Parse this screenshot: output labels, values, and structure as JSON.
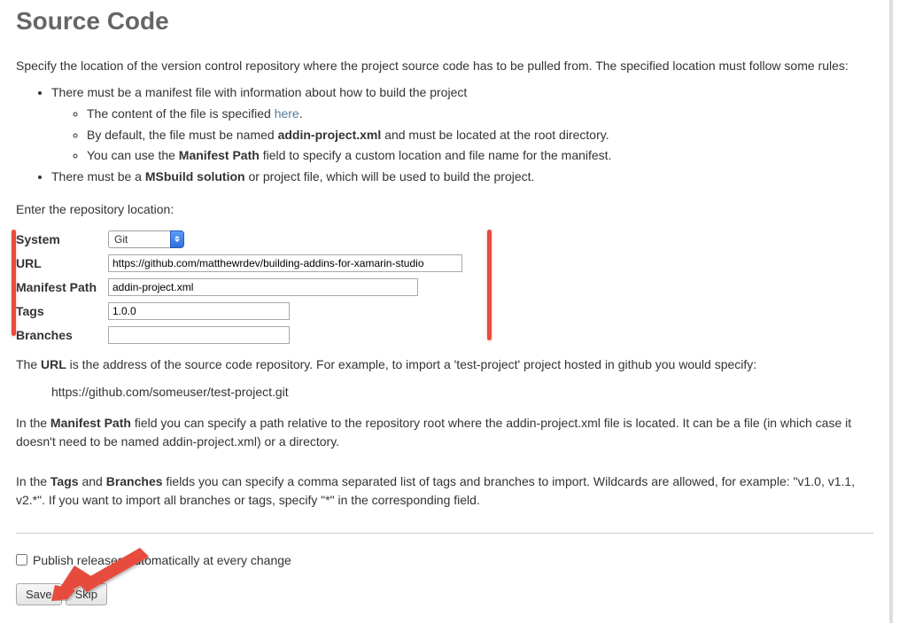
{
  "heading": "Source Code",
  "intro": "Specify the location of the version control repository where the project source code has to be pulled from. The specified location must follow some rules:",
  "rules": {
    "item1": "There must be a manifest file with information about how to build the project",
    "sub1a_prefix": "The content of the file is specified ",
    "sub1a_link": "here",
    "sub1a_suffix": ".",
    "sub1b_prefix": "By default, the file must be named ",
    "sub1b_bold": "addin-project.xml",
    "sub1b_suffix": " and must be located at the root directory.",
    "sub1c_prefix": "You can use the ",
    "sub1c_bold": "Manifest Path",
    "sub1c_suffix": " field to specify a custom location and file name for the manifest.",
    "item2_prefix": "There must be a ",
    "item2_bold": "MSbuild solution",
    "item2_suffix": " or project file, which will be used to build the project."
  },
  "enter_location": "Enter the repository location:",
  "form": {
    "system_label": "System",
    "system_value": "Git",
    "url_label": "URL",
    "url_value": "https://github.com/matthewrdev/building-addins-for-xamarin-studio",
    "manifest_label": "Manifest Path",
    "manifest_value": "addin-project.xml",
    "tags_label": "Tags",
    "tags_value": "1.0.0",
    "branches_label": "Branches",
    "branches_value": ""
  },
  "url_help": {
    "prefix": "The ",
    "bold": "URL",
    "suffix": " is the address of the source code repository. For example, to import a 'test-project' project hosted in github you would specify:"
  },
  "url_example": "https://github.com/someuser/test-project.git",
  "manifest_help": {
    "prefix": "In the ",
    "bold": "Manifest Path",
    "suffix": " field you can specify a path relative to the repository root where the addin-project.xml file is located. It can be a file (in which case it doesn't need to be named addin-project.xml) or a directory."
  },
  "tags_help": {
    "prefix": "In the ",
    "bold1": "Tags",
    "mid": " and ",
    "bold2": "Branches",
    "suffix": " fields you can specify a comma separated list of tags and branches to import. Wildcards are allowed, for example: \"v1.0, v1.1, v2.*\". If you want to import all branches or tags, specify \"*\" in the corresponding field."
  },
  "publish_checkbox": "Publish releases automatically at every change",
  "buttons": {
    "save": "Save",
    "skip": "Skip"
  }
}
